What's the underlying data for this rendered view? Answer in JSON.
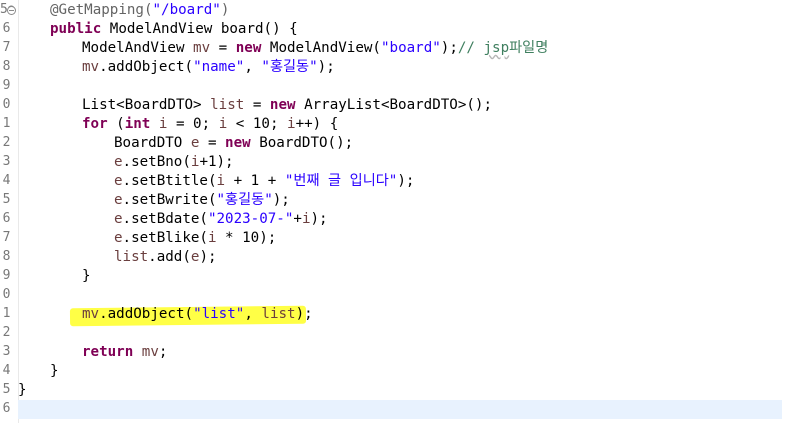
{
  "editor": {
    "lines": [
      {
        "num": "5⊖",
        "indent": 1,
        "tokens": [
          {
            "t": "@GetMapping(",
            "c": "ann"
          },
          {
            "t": "\"/board\"",
            "c": "str"
          },
          {
            "t": ")",
            "c": "ann"
          }
        ]
      },
      {
        "num": "6",
        "indent": 1,
        "tokens": [
          {
            "t": "public",
            "c": "kw"
          },
          {
            "t": " ModelAndView board() {",
            "c": "plain"
          }
        ]
      },
      {
        "num": "7",
        "indent": 2,
        "tokens": [
          {
            "t": "ModelAndView ",
            "c": "plain"
          },
          {
            "t": "mv",
            "c": "var"
          },
          {
            "t": " = ",
            "c": "plain"
          },
          {
            "t": "new",
            "c": "kw"
          },
          {
            "t": " ModelAndView(",
            "c": "plain"
          },
          {
            "t": "\"board\"",
            "c": "str"
          },
          {
            "t": ");",
            "c": "plain"
          },
          {
            "t": "// ",
            "c": "cmt"
          },
          {
            "t": "jsp",
            "c": "cmt typo"
          },
          {
            "t": "파일명",
            "c": "cmt"
          }
        ]
      },
      {
        "num": "8",
        "indent": 2,
        "tokens": [
          {
            "t": "mv",
            "c": "var"
          },
          {
            "t": ".addObject(",
            "c": "plain"
          },
          {
            "t": "\"name\"",
            "c": "str"
          },
          {
            "t": ", ",
            "c": "plain"
          },
          {
            "t": "\"홍길동\"",
            "c": "str"
          },
          {
            "t": ");",
            "c": "plain"
          }
        ]
      },
      {
        "num": "9",
        "indent": 0,
        "tokens": []
      },
      {
        "num": "0",
        "indent": 2,
        "tokens": [
          {
            "t": "List<BoardDTO> ",
            "c": "plain"
          },
          {
            "t": "list",
            "c": "var"
          },
          {
            "t": " = ",
            "c": "plain"
          },
          {
            "t": "new",
            "c": "kw"
          },
          {
            "t": " ArrayList<BoardDTO>();",
            "c": "plain"
          }
        ]
      },
      {
        "num": "1",
        "indent": 2,
        "tokens": [
          {
            "t": "for",
            "c": "kw"
          },
          {
            "t": " (",
            "c": "plain"
          },
          {
            "t": "int",
            "c": "kw"
          },
          {
            "t": " ",
            "c": "plain"
          },
          {
            "t": "i",
            "c": "var"
          },
          {
            "t": " = 0; ",
            "c": "plain"
          },
          {
            "t": "i",
            "c": "var"
          },
          {
            "t": " < 10; ",
            "c": "plain"
          },
          {
            "t": "i",
            "c": "var"
          },
          {
            "t": "++) {",
            "c": "plain"
          }
        ]
      },
      {
        "num": "2",
        "indent": 3,
        "tokens": [
          {
            "t": "BoardDTO ",
            "c": "plain"
          },
          {
            "t": "e",
            "c": "var"
          },
          {
            "t": " = ",
            "c": "plain"
          },
          {
            "t": "new",
            "c": "kw"
          },
          {
            "t": " BoardDTO();",
            "c": "plain"
          }
        ]
      },
      {
        "num": "3",
        "indent": 3,
        "tokens": [
          {
            "t": "e",
            "c": "var"
          },
          {
            "t": ".setBno(",
            "c": "plain"
          },
          {
            "t": "i",
            "c": "var"
          },
          {
            "t": "+1);",
            "c": "plain"
          }
        ]
      },
      {
        "num": "4",
        "indent": 3,
        "tokens": [
          {
            "t": "e",
            "c": "var"
          },
          {
            "t": ".setBtitle(",
            "c": "plain"
          },
          {
            "t": "i",
            "c": "var"
          },
          {
            "t": " + 1 + ",
            "c": "plain"
          },
          {
            "t": "\"번째 글 입니다\"",
            "c": "str"
          },
          {
            "t": ");",
            "c": "plain"
          }
        ]
      },
      {
        "num": "5",
        "indent": 3,
        "tokens": [
          {
            "t": "e",
            "c": "var"
          },
          {
            "t": ".setBwrite(",
            "c": "plain"
          },
          {
            "t": "\"홍길동\"",
            "c": "str"
          },
          {
            "t": ");",
            "c": "plain"
          }
        ]
      },
      {
        "num": "6",
        "indent": 3,
        "tokens": [
          {
            "t": "e",
            "c": "var"
          },
          {
            "t": ".setBdate(",
            "c": "plain"
          },
          {
            "t": "\"2023-07-\"",
            "c": "str"
          },
          {
            "t": "+",
            "c": "plain"
          },
          {
            "t": "i",
            "c": "var"
          },
          {
            "t": ");",
            "c": "plain"
          }
        ]
      },
      {
        "num": "7",
        "indent": 3,
        "tokens": [
          {
            "t": "e",
            "c": "var"
          },
          {
            "t": ".setBlike(",
            "c": "plain"
          },
          {
            "t": "i",
            "c": "var"
          },
          {
            "t": " * 10);",
            "c": "plain"
          }
        ]
      },
      {
        "num": "8",
        "indent": 3,
        "tokens": [
          {
            "t": "list",
            "c": "var"
          },
          {
            "t": ".add(",
            "c": "plain"
          },
          {
            "t": "e",
            "c": "var"
          },
          {
            "t": ");",
            "c": "plain"
          }
        ]
      },
      {
        "num": "9",
        "indent": 2,
        "tokens": [
          {
            "t": "}",
            "c": "plain"
          }
        ]
      },
      {
        "num": "0",
        "indent": 0,
        "tokens": []
      },
      {
        "num": "1",
        "indent": 2,
        "tokens": [
          {
            "t": "mv",
            "c": "var"
          },
          {
            "t": ".addObject(",
            "c": "plain"
          },
          {
            "t": "\"list\"",
            "c": "str"
          },
          {
            "t": ", ",
            "c": "plain"
          },
          {
            "t": "list",
            "c": "var"
          },
          {
            "t": ");",
            "c": "plain"
          }
        ]
      },
      {
        "num": "2",
        "indent": 0,
        "tokens": []
      },
      {
        "num": "3",
        "indent": 2,
        "tokens": [
          {
            "t": "return",
            "c": "kw"
          },
          {
            "t": " ",
            "c": "plain"
          },
          {
            "t": "mv",
            "c": "var"
          },
          {
            "t": ";",
            "c": "plain"
          }
        ]
      },
      {
        "num": "4",
        "indent": 1,
        "tokens": [
          {
            "t": "}",
            "c": "plain"
          }
        ]
      },
      {
        "num": "5",
        "indent": 0,
        "tokens": [
          {
            "t": "}",
            "c": "plain"
          }
        ]
      },
      {
        "num": "6",
        "indent": 0,
        "tokens": []
      }
    ]
  },
  "colors": {
    "keyword": "#7f0055",
    "string": "#2a00ff",
    "annotation": "#646464",
    "comment": "#3f7f5f",
    "local_variable": "#6a3e3e",
    "highlight": "#ffff3c",
    "current_line": "#e8f2fe"
  },
  "icons": {
    "fold_marker": "collapse-fold-icon"
  }
}
